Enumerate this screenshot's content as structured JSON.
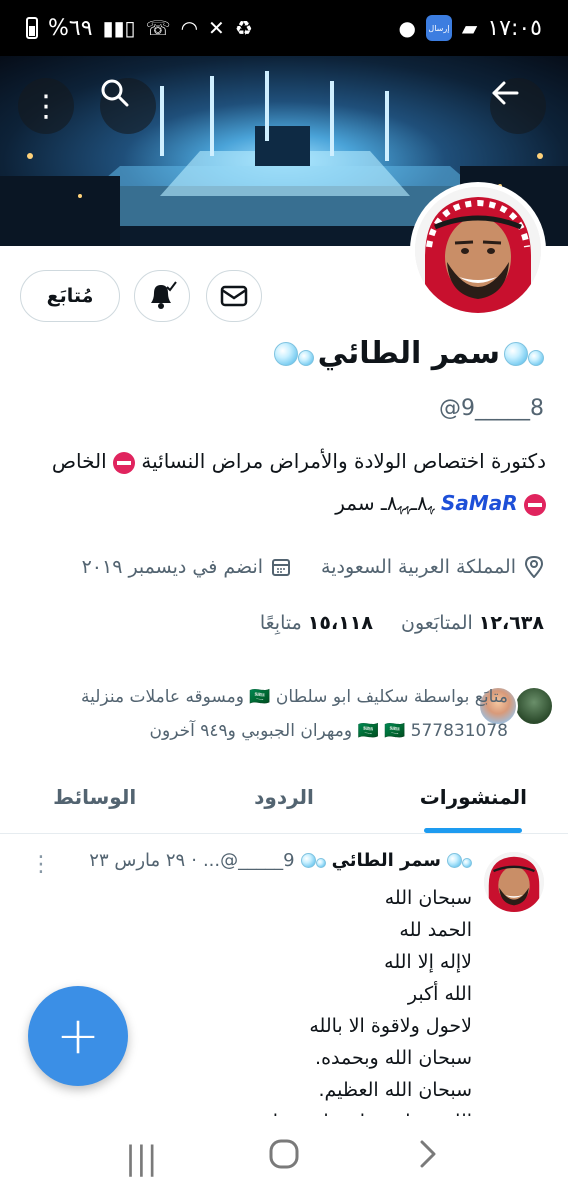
{
  "status_bar": {
    "time": "١٧:٠٥",
    "battery": "%٦٩",
    "app_badge": "إرسال"
  },
  "profile": {
    "name": "سمر الطائي",
    "handle": "@9_____8",
    "bio_line1": "دكتورة اختصاص الولادة والأمراض مراض النسائية",
    "bio_line1_tail": "الخاص",
    "bio_line2_brand": "SaMaR",
    "bio_line2_tail": "ﮩ٨ـﮩﮩ٨ـ سمر",
    "location": "المملكة العربية السعودية",
    "joined": "انضم في ديسمبر ٢٠١٩",
    "followers_count": "١٢،٦٣٨",
    "followers_label": "المتابَعون",
    "following_count": "١٥،١١٨",
    "following_label": "متابِعًا",
    "followed_by_line1": "متابَع بواسطة سكليف ابو سلطان 🇸🇦 ومسوقه عاملات منزلية",
    "followed_by_line2": "577831078 🇸🇦 🇸🇦 ومهران الجبوبي و٩٤٩ آخرون"
  },
  "buttons": {
    "follow_label": "مُتابَع"
  },
  "tabs": [
    {
      "label": "المنشورات",
      "active": true
    },
    {
      "label": "الردود",
      "active": false
    },
    {
      "label": "الوسائط",
      "active": false
    }
  ],
  "tweet": {
    "author": "سمر الطائي",
    "handle": "9_____@...",
    "dot": "·",
    "date": "٢٩ مارس ٢٣",
    "lines": [
      "سبحان الله",
      "الحمد لله",
      "لاإله إلا الله",
      "الله أكبر",
      "لاحول ولاقوة الا بالله",
      "سبحان الله وبحمده.",
      "سبحان الله العظيم.",
      "اللهم صل وسلم على نبينا"
    ]
  },
  "icons": {
    "back": "arrow-back-icon",
    "search": "search-icon",
    "more": "more-vertical-icon",
    "bell": "bell-icon",
    "mail": "mail-icon",
    "location": "location-icon",
    "calendar": "calendar-icon",
    "compose": "compose-plus-icon"
  },
  "colors": {
    "accent": "#1d9bf0",
    "fab": "#3b8fe6",
    "text_primary": "#0f1419",
    "text_secondary": "#536471"
  }
}
